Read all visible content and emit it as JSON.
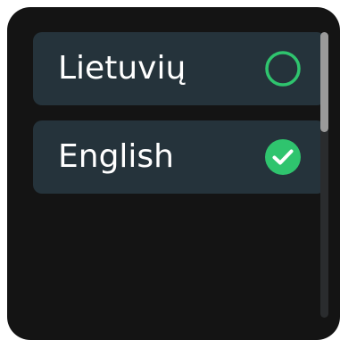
{
  "language_list": {
    "items": [
      {
        "label": "Lietuvių",
        "selected": false,
        "indicator_icon": "radio-unchecked-icon"
      },
      {
        "label": "English",
        "selected": true,
        "indicator_icon": "check-circle-icon"
      }
    ]
  },
  "colors": {
    "background": "#141414",
    "item_background": "#25333b",
    "accent": "#2fc46e",
    "text": "#ffffff",
    "scroll_thumb": "#9a9a9a",
    "scroll_track": "#2a2c2e"
  }
}
